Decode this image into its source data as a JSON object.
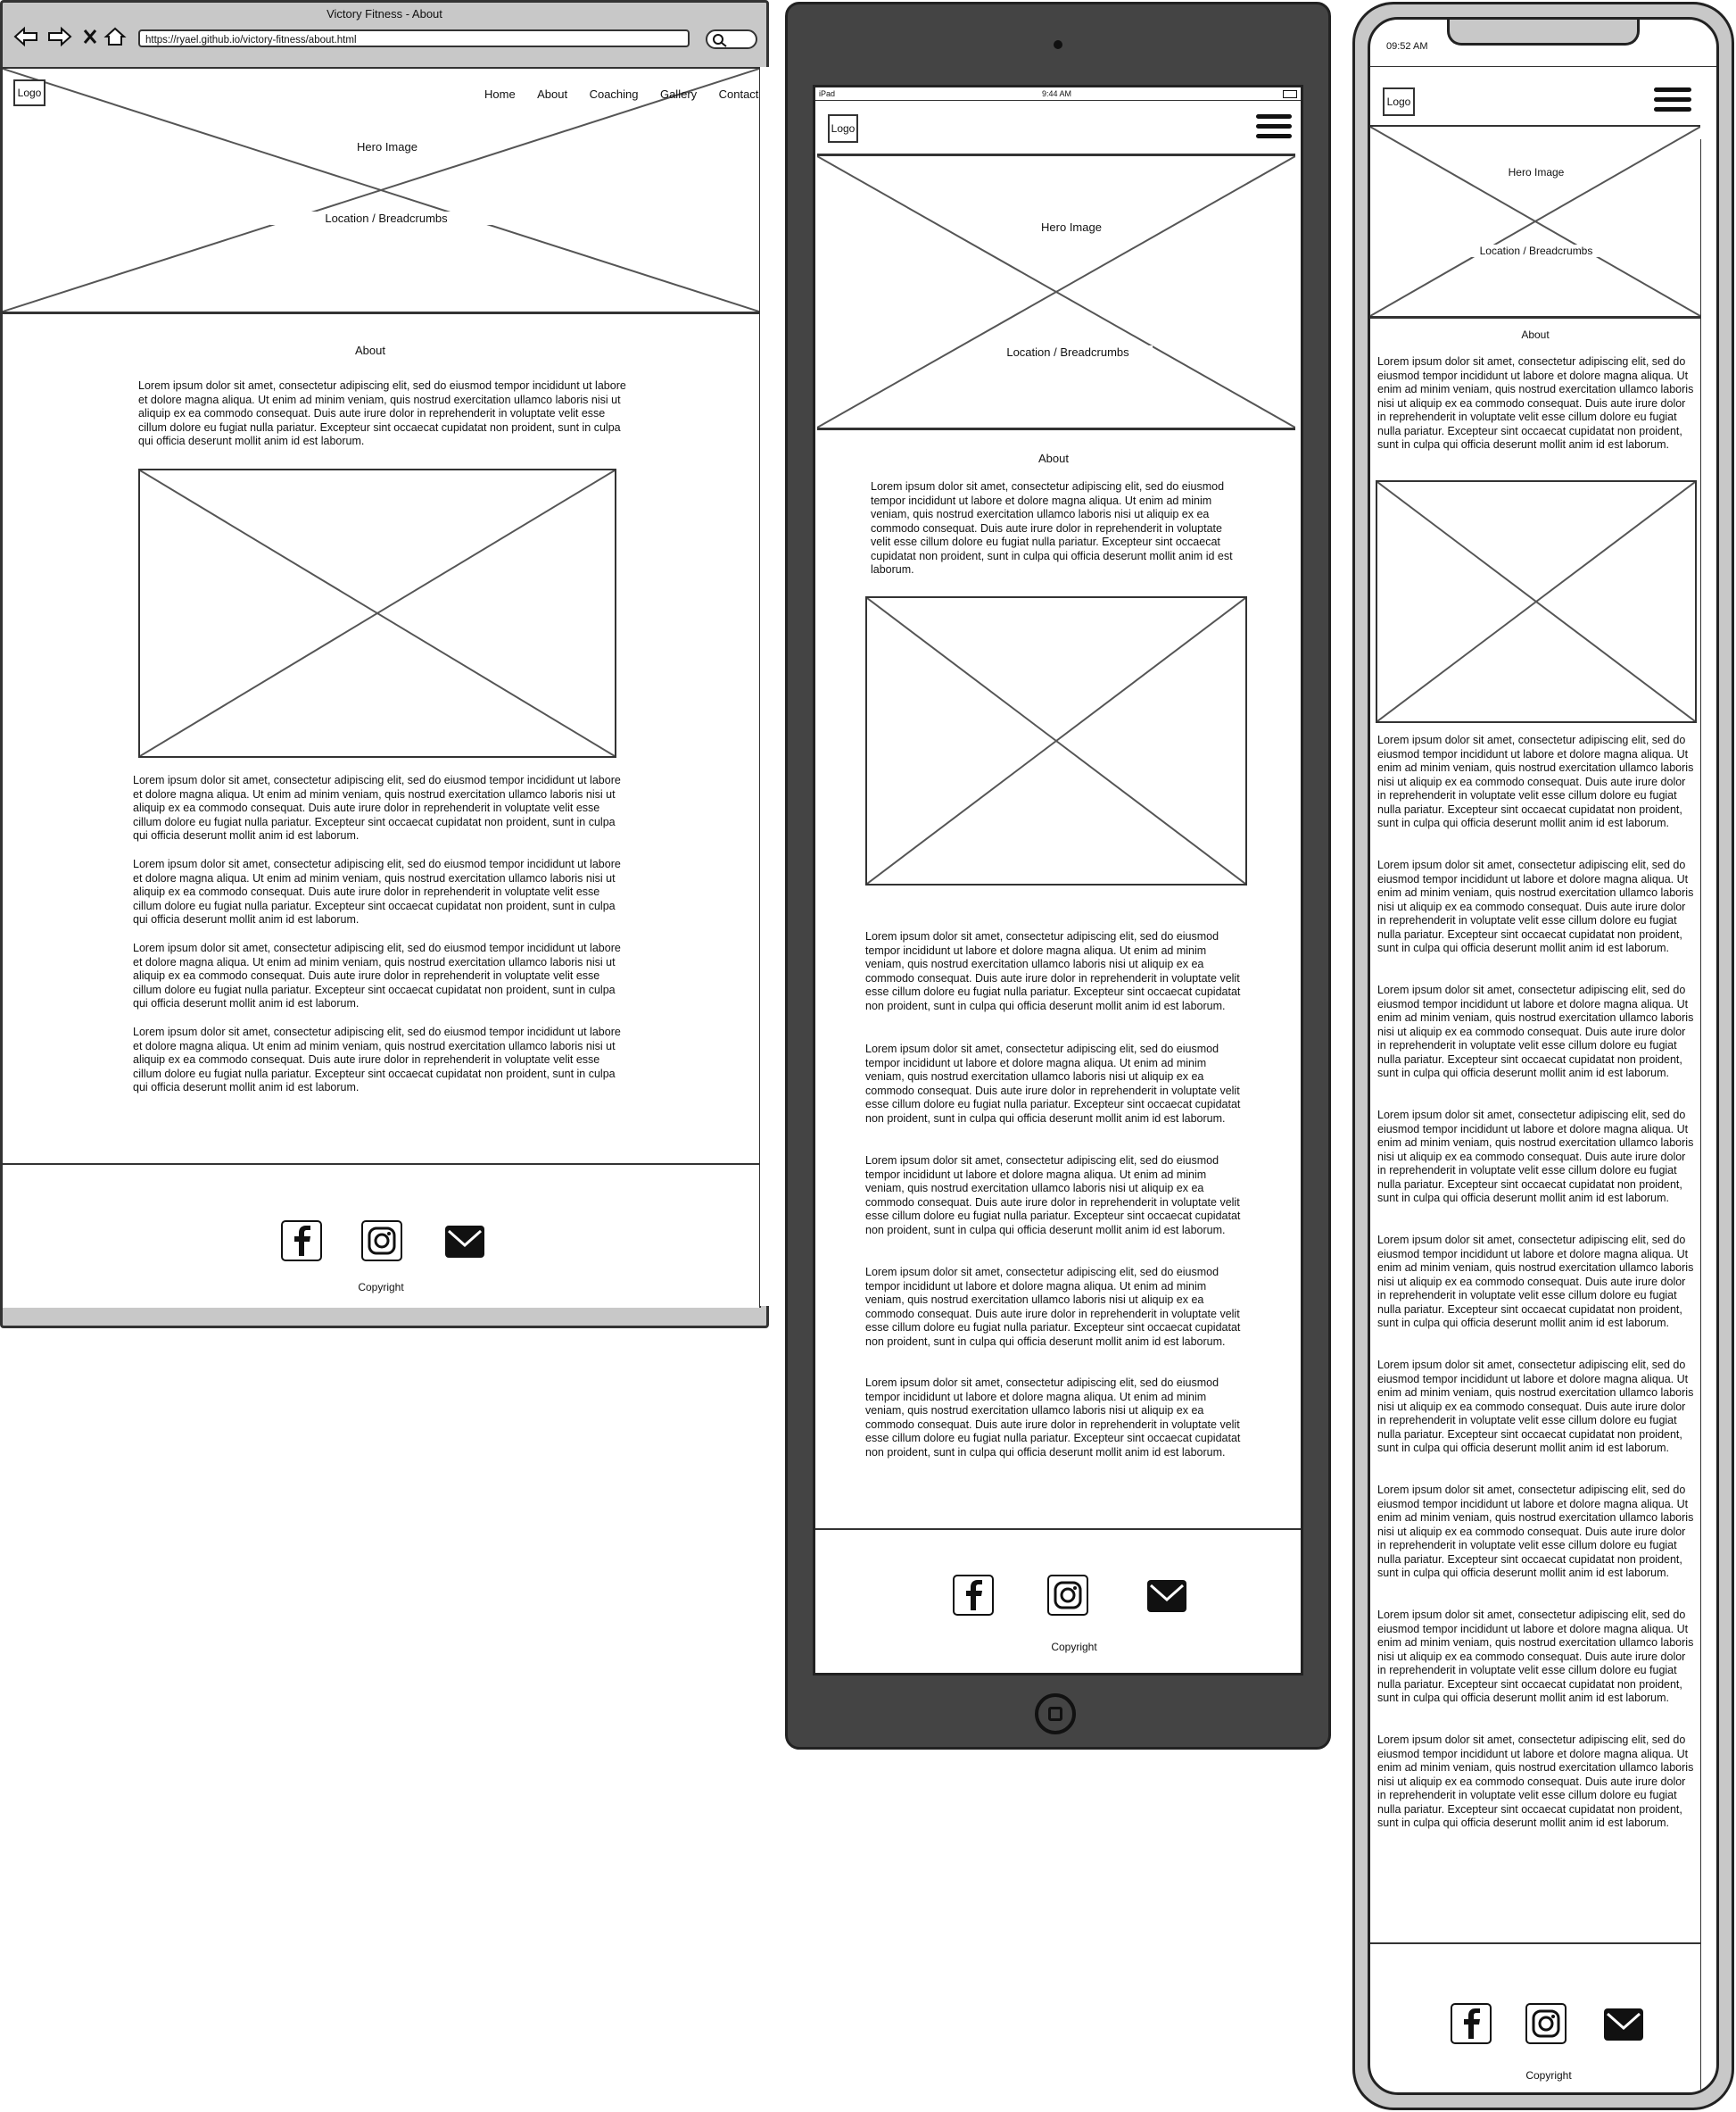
{
  "desktop": {
    "window_title": "Victory Fitness - About",
    "url": "https://ryael.github.io/victory-fitness/about.html",
    "logo": "Logo",
    "nav": [
      "Home",
      "About",
      "Coaching",
      "Gallery",
      "Contact"
    ],
    "hero_label": "Hero Image",
    "breadcrumbs_label": "Location / Breadcrumbs",
    "section_title": "About",
    "copyright": "Copyright"
  },
  "tablet": {
    "device_label": "iPad",
    "time": "9:44 AM",
    "logo": "Logo",
    "hero_label": "Hero Image",
    "breadcrumbs_label": "Location / Breadcrumbs",
    "section_title": "About",
    "copyright": "Copyright"
  },
  "phone": {
    "time": "09:52 AM",
    "logo": "Logo",
    "hero_label": "Hero Image",
    "breadcrumbs_label": "Location / Breadcrumbs",
    "section_title": "About",
    "copyright": "Copyright"
  },
  "lorem": "Lorem ipsum dolor sit amet, consectetur adipiscing elit, sed do eiusmod tempor incididunt ut labore et dolore magna aliqua. Ut enim ad minim veniam, quis nostrud exercitation ullamco laboris nisi ut aliquip ex ea commodo consequat. Duis aute irure dolor in reprehenderit in voluptate velit esse cillum dolore eu fugiat nulla pariatur. Excepteur sint occaecat cupidatat non proident, sunt in culpa qui officia deserunt mollit anim id est laborum.",
  "icons": [
    "facebook-icon",
    "instagram-icon",
    "email-icon"
  ]
}
